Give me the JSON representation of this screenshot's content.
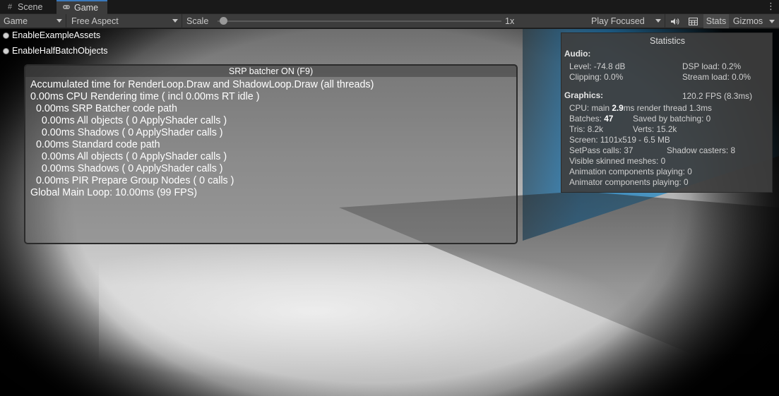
{
  "tabs": [
    {
      "label": "Scene",
      "icon": "grid-icon"
    },
    {
      "label": "Game",
      "icon": "gamepad-icon",
      "active": true
    }
  ],
  "toolbar": {
    "display": "Game",
    "aspect": "Free Aspect",
    "scale_label": "Scale",
    "scale_value": "1x",
    "scale_fraction": 0.02,
    "play_mode": "Play Focused",
    "stats_label": "Stats",
    "gizmos_label": "Gizmos"
  },
  "toggles": [
    {
      "label": "EnableExampleAssets"
    },
    {
      "label": "EnableHalfBatchObjects"
    }
  ],
  "srp": {
    "title": "SRP batcher ON (F9)",
    "lines": [
      "Accumulated time for RenderLoop.Draw and ShadowLoop.Draw (all threads)",
      "0.00ms CPU Rendering time ( incl 0.00ms RT idle )",
      "  0.00ms SRP Batcher code path",
      "    0.00ms All objects ( 0 ApplyShader calls )",
      "    0.00ms Shadows ( 0 ApplyShader calls )",
      "  0.00ms Standard code path",
      "    0.00ms All objects ( 0 ApplyShader calls )",
      "    0.00ms Shadows ( 0 ApplyShader calls )",
      "  0.00ms PIR Prepare Group Nodes ( 0 calls )",
      "Global Main Loop: 10.00ms (99 FPS)"
    ]
  },
  "stats": {
    "title": "Statistics",
    "audio_heading": "Audio:",
    "level": "Level: -74.8 dB",
    "dsp_load": "DSP load: 0.2%",
    "clipping": "Clipping: 0.0%",
    "stream_load": "Stream load: 0.0%",
    "graphics_heading": "Graphics:",
    "fps": "120.2 FPS (8.3ms)",
    "cpu_prefix": "CPU: main ",
    "cpu_main": "2.9",
    "cpu_suffix": "ms  render thread 1.3ms",
    "batches_prefix": "Batches: ",
    "batches": "47",
    "saved_batching": "Saved by batching: 0",
    "tris": "Tris: 8.2k",
    "verts": "Verts: 15.2k",
    "screen": "Screen: 1101x519 - 6.5 MB",
    "setpass": "SetPass calls: 37",
    "shadow_casters": "Shadow casters: 8",
    "skinned": "Visible skinned meshes: 0",
    "animation": "Animation components playing: 0",
    "animator": "Animator components playing: 0"
  }
}
